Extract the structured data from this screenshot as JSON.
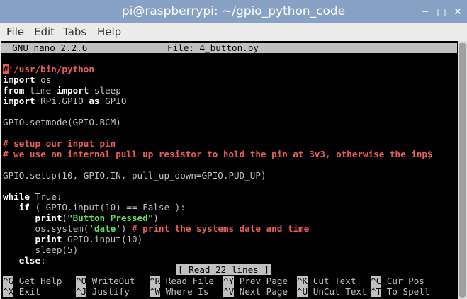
{
  "window": {
    "title": "pi@raspberrypi: ~/gpio_python_code",
    "minimize": "─",
    "maximize": "□",
    "close": "✕"
  },
  "menu": [
    "File",
    "Edit",
    "Tabs",
    "Help"
  ],
  "nano": {
    "version": "  GNU nano 2.2.6",
    "file": "File: 4_button.py"
  },
  "code": {
    "shebang_cursor": "#",
    "shebang_rest": "!/usr/bin/python",
    "l2_kw": "import",
    "l2_rest": " os",
    "l3_kw1": "from",
    "l3_mid": " time ",
    "l3_kw2": "import",
    "l3_rest": " sleep",
    "l4_kw1": "import",
    "l4_mid": " RPi.GPIO ",
    "l4_kw2": "as",
    "l4_rest": " GPIO",
    "l6": "GPIO.setmode(GPIO.BCM)",
    "l8": "# setup our input pin",
    "l9": "# we use an internal pull up resistor to hold the pin at 3v3, otherwise the inp$",
    "l11": "GPIO.setup(10, GPIO.IN, pull_up_down=GPIO.PUD_UP)",
    "l13_kw": "while",
    "l13_rest": " True:",
    "l14_indent": "   ",
    "l14_kw": "if",
    "l14_rest": " ( GPIO.input(10) == False ):",
    "l15_indent": "      ",
    "l15_kw": "print",
    "l15_p1": "(",
    "l15_str": "\"Button Pressed\"",
    "l15_p2": ")",
    "l16_pre": "      os.system(",
    "l16_str": "'date'",
    "l16_mid": ") ",
    "l16_cmt": "# print the systems date and time",
    "l17_indent": "      ",
    "l17_kw": "print",
    "l17_rest": " GPIO.input(10)",
    "l18": "      sleep(5)",
    "l19_indent": "   ",
    "l19_kw": "else",
    "l19_rest": ":"
  },
  "status": "[ Read 22 lines ]",
  "shortcuts_row1": [
    {
      "key": "^G",
      "label": " Get Help"
    },
    {
      "key": "^O",
      "label": " WriteOut"
    },
    {
      "key": "^R",
      "label": " Read File"
    },
    {
      "key": "^Y",
      "label": " Prev Page"
    },
    {
      "key": "^K",
      "label": " Cut Text"
    },
    {
      "key": "^C",
      "label": " Cur Pos"
    }
  ],
  "shortcuts_row2": [
    {
      "key": "^X",
      "label": " Exit"
    },
    {
      "key": "^J",
      "label": " Justify"
    },
    {
      "key": "^W",
      "label": " Where Is"
    },
    {
      "key": "^V",
      "label": " Next Page"
    },
    {
      "key": "^U",
      "label": " UnCut Text"
    },
    {
      "key": "^T",
      "label": " To Spell"
    }
  ]
}
